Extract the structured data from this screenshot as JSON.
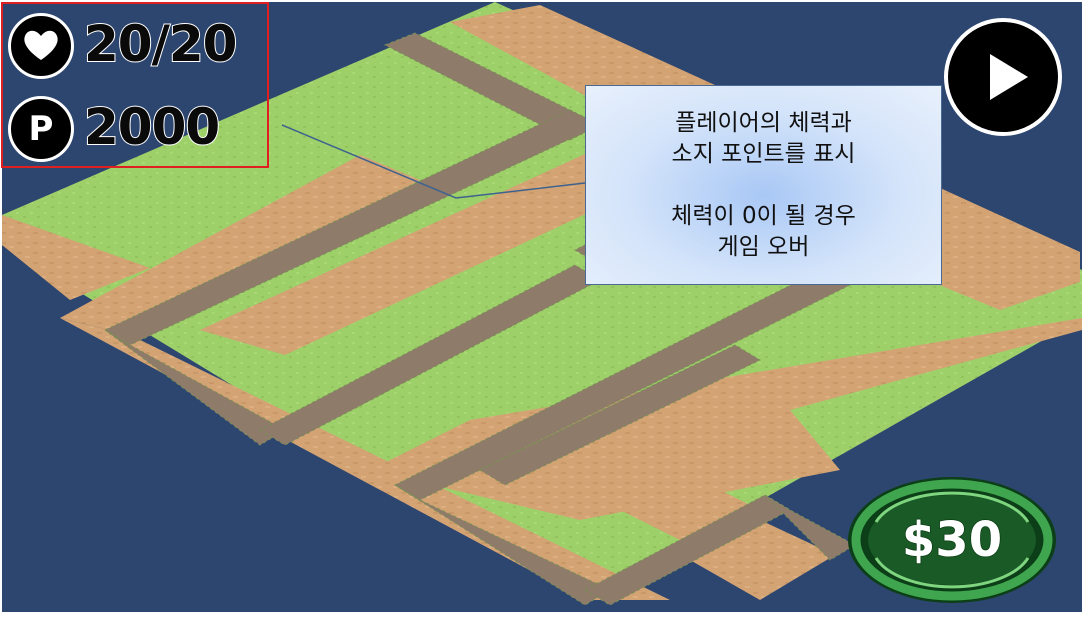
{
  "hud": {
    "health_value": "20/20",
    "points_value": "2000",
    "health_icon": "heart-icon",
    "points_icon": "points-p-icon",
    "points_letter": "P"
  },
  "controls": {
    "play_icon": "play-icon",
    "tower_price": "$30"
  },
  "annotation": {
    "line1": "플레이어의 체력과",
    "line2": "소지 포인트를 표시",
    "line3": "체력이 0이 될 경우",
    "line4": "게임 오버"
  },
  "colors": {
    "background": "#2c4670",
    "grass": "#9ed06a",
    "dirt": "#d3a373",
    "path_tile": "#8e7b6a",
    "highlight_border": "#e02020"
  }
}
